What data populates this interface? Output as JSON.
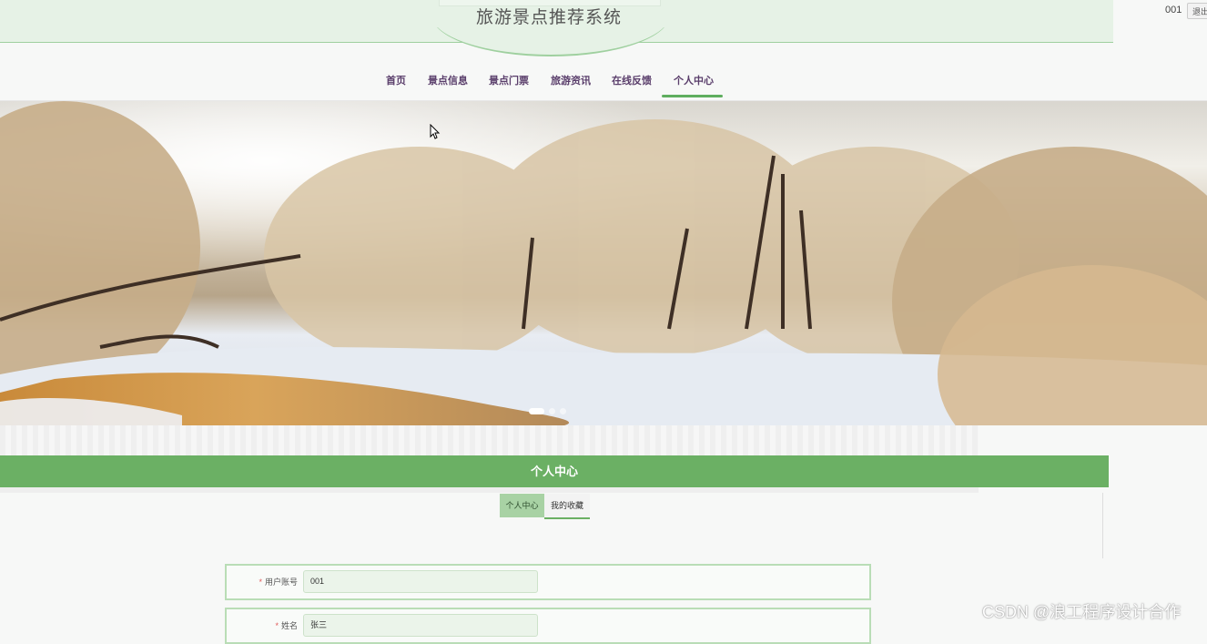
{
  "header": {
    "site_title": "旅游景点推荐系统",
    "user_name": "001",
    "logout_label": "退出"
  },
  "nav": {
    "items": [
      {
        "label": "首页"
      },
      {
        "label": "景点信息"
      },
      {
        "label": "景点门票"
      },
      {
        "label": "旅游资讯"
      },
      {
        "label": "在线反馈"
      },
      {
        "label": "个人中心",
        "active": true
      }
    ]
  },
  "banner": {
    "slide_count": 3,
    "active_slide": 1
  },
  "section": {
    "title": "个人中心"
  },
  "tabs": [
    {
      "label": "个人中心",
      "active": true
    },
    {
      "label": "我的收藏",
      "active": false
    }
  ],
  "form": {
    "fields": [
      {
        "label": "用户账号",
        "value": "001",
        "required": true
      },
      {
        "label": "姓名",
        "value": "张三",
        "required": true
      }
    ]
  },
  "watermark": "CSDN @浪工程序设计合作",
  "colors": {
    "accent_green": "#6bb064",
    "header_bg": "#e6f2e6",
    "nav_text": "#5a3e6b"
  }
}
